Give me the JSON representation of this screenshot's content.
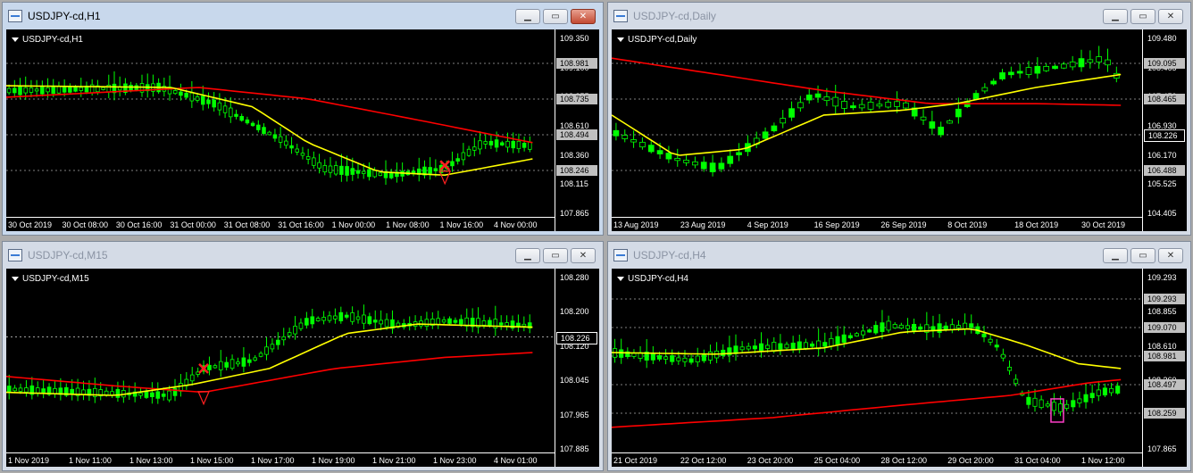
{
  "windows": [
    {
      "id": "h1",
      "title": "USDJPY-cd,H1",
      "chart_label": "USDJPY-cd,H1",
      "active": true,
      "price_ticks": [
        "109.350",
        "109.100",
        "108.855",
        "108.610",
        "108.360",
        "108.115",
        "107.865"
      ],
      "price_markers": [
        {
          "value": "108.981",
          "style": "box"
        },
        {
          "value": "108.735",
          "style": "box"
        },
        {
          "value": "108.494",
          "style": "box"
        },
        {
          "value": "108.246",
          "style": "box"
        }
      ],
      "time_ticks": [
        "30 Oct 2019",
        "30 Oct 08:00",
        "30 Oct 16:00",
        "31 Oct 00:00",
        "31 Oct 08:00",
        "31 Oct 16:00",
        "1 Nov 00:00",
        "1 Nov 08:00",
        "1 Nov 16:00",
        "4 Nov 00:00"
      ]
    },
    {
      "id": "daily",
      "title": "USDJPY-cd,Daily",
      "chart_label": "USDJPY-cd,Daily",
      "active": false,
      "price_ticks": [
        "109.480",
        "108.465",
        "107.450",
        "106.930",
        "106.170",
        "105.525",
        "104.405"
      ],
      "price_markers": [
        {
          "value": "109.095",
          "style": "box"
        },
        {
          "value": "108.465",
          "style": "box"
        },
        {
          "value": "108.226",
          "style": "boxdark"
        },
        {
          "value": "106.488",
          "style": "box"
        }
      ],
      "time_ticks": [
        "13 Aug 2019",
        "23 Aug 2019",
        "4 Sep 2019",
        "16 Sep 2019",
        "26 Sep 2019",
        "8 Oct 2019",
        "18 Oct 2019",
        "30 Oct 2019"
      ]
    },
    {
      "id": "m15",
      "title": "USDJPY-cd,M15",
      "chart_label": "USDJPY-cd,M15",
      "active": false,
      "price_ticks": [
        "108.280",
        "108.200",
        "108.120",
        "108.045",
        "107.965",
        "107.885"
      ],
      "price_markers": [
        {
          "value": "108.226",
          "style": "boxdark"
        }
      ],
      "time_ticks": [
        "1 Nov 2019",
        "1 Nov 11:00",
        "1 Nov 13:00",
        "1 Nov 15:00",
        "1 Nov 17:00",
        "1 Nov 19:00",
        "1 Nov 21:00",
        "1 Nov 23:00",
        "4 Nov 01:00"
      ]
    },
    {
      "id": "h4",
      "title": "USDJPY-cd,H4",
      "chart_label": "USDJPY-cd,H4",
      "active": false,
      "price_ticks": [
        "109.293",
        "108.855",
        "108.610",
        "108.360",
        "108.115",
        "107.865"
      ],
      "price_markers": [
        {
          "value": "109.293",
          "style": "box"
        },
        {
          "value": "109.070",
          "style": "box"
        },
        {
          "value": "108.981",
          "style": "box"
        },
        {
          "value": "108.497",
          "style": "box"
        },
        {
          "value": "108.259",
          "style": "box"
        }
      ],
      "time_ticks": [
        "21 Oct 2019",
        "22 Oct 12:00",
        "23 Oct 20:00",
        "25 Oct 04:00",
        "28 Oct 12:00",
        "29 Oct 20:00",
        "31 Oct 04:00",
        "1 Nov 12:00"
      ]
    }
  ],
  "window_buttons": {
    "minimize": "▁",
    "maximize": "▭",
    "close": "✕"
  },
  "colors": {
    "bull": "#00ff00",
    "ma_fast": "#ffff00",
    "ma_slow": "#ff0000",
    "grid": "#ffffff",
    "background": "#000000"
  }
}
